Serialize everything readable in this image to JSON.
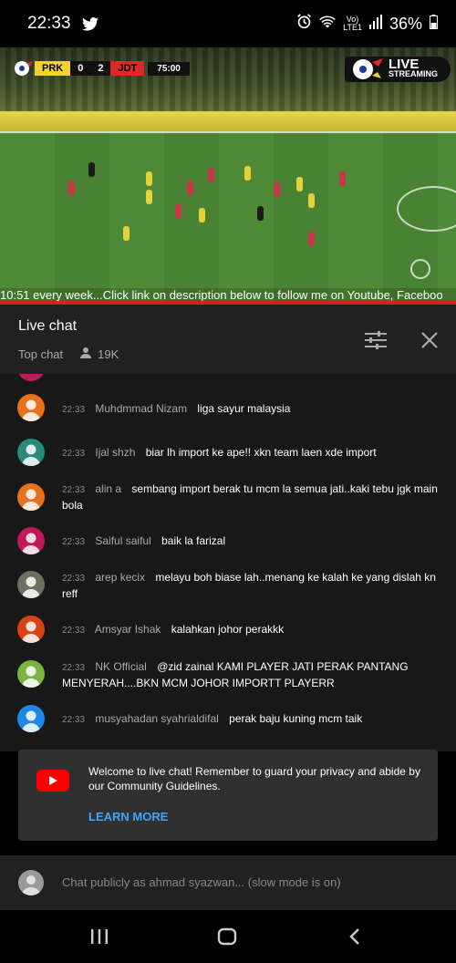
{
  "status_bar": {
    "time": "22:33",
    "volte_top": "Vo)",
    "volte_bottom": "LTE1",
    "battery": "36%"
  },
  "video": {
    "scoreboard": {
      "team1": "PRK",
      "score1": "0",
      "score2": "2",
      "team2": "JDT",
      "clock": "75:00"
    },
    "live_badge": {
      "line1": "LIVE",
      "line2": "STREAMING"
    },
    "ticker": "10:51 every week...Click link on description below to follow me on Youtube, Faceboo"
  },
  "chat_header": {
    "title": "Live chat",
    "filter": "Top chat",
    "viewers": "19K"
  },
  "messages": [
    {
      "time": "22:33",
      "author": "Muhdmmad Nizam",
      "text": "liga sayur malaysia",
      "color": "#e8711e"
    },
    {
      "time": "22:33",
      "author": "Ijal shzh",
      "text": "biar lh import ke ape!! xkn team laen xde import",
      "color": "#29897b"
    },
    {
      "time": "22:33",
      "author": "alin a",
      "text": "sembang import berak tu mcm la semua jati..kaki tebu jgk main bola",
      "color": "#e8711e"
    },
    {
      "time": "22:33",
      "author": "Saiful saiful",
      "text": "baik la farizal",
      "color": "#c2185b"
    },
    {
      "time": "22:33",
      "author": "arep kecix",
      "text": "melayu boh biase lah..menang ke kalah ke yang dislah kn reff",
      "color": "#6f6f5f"
    },
    {
      "time": "22:33",
      "author": "Amsyar Ishak",
      "text": "kalahkan johor perakkk",
      "color": "#d84315"
    },
    {
      "time": "22:33",
      "author": "NK Official",
      "text": "@zid zainal KAMI PLAYER JATI PERAK PANTANG MENYERAH....BKN MCM JOHOR IMPORTT PLAYERR",
      "color": "#7cb342"
    },
    {
      "time": "22:33",
      "author": "musyahadan syahrialdifal",
      "text": "perak baju kuning mcm taik",
      "color": "#1e88e5"
    }
  ],
  "welcome": {
    "text": "Welcome to live chat! Remember to guard your privacy and abide by our Community Guidelines.",
    "learn_more": "LEARN MORE"
  },
  "input": {
    "placeholder": "Chat publicly as ahmad syazwan... (slow mode is on)"
  },
  "icons": {
    "twitter": "twitter-icon",
    "alarm": "alarm-icon",
    "wifi": "wifi-icon",
    "signal": "signal-icon",
    "battery": "battery-icon",
    "person": "person-icon",
    "filter": "sliders-icon",
    "close": "close-icon",
    "youtube": "youtube-icon",
    "recents": "recents-icon",
    "home": "home-icon",
    "back": "back-icon"
  }
}
